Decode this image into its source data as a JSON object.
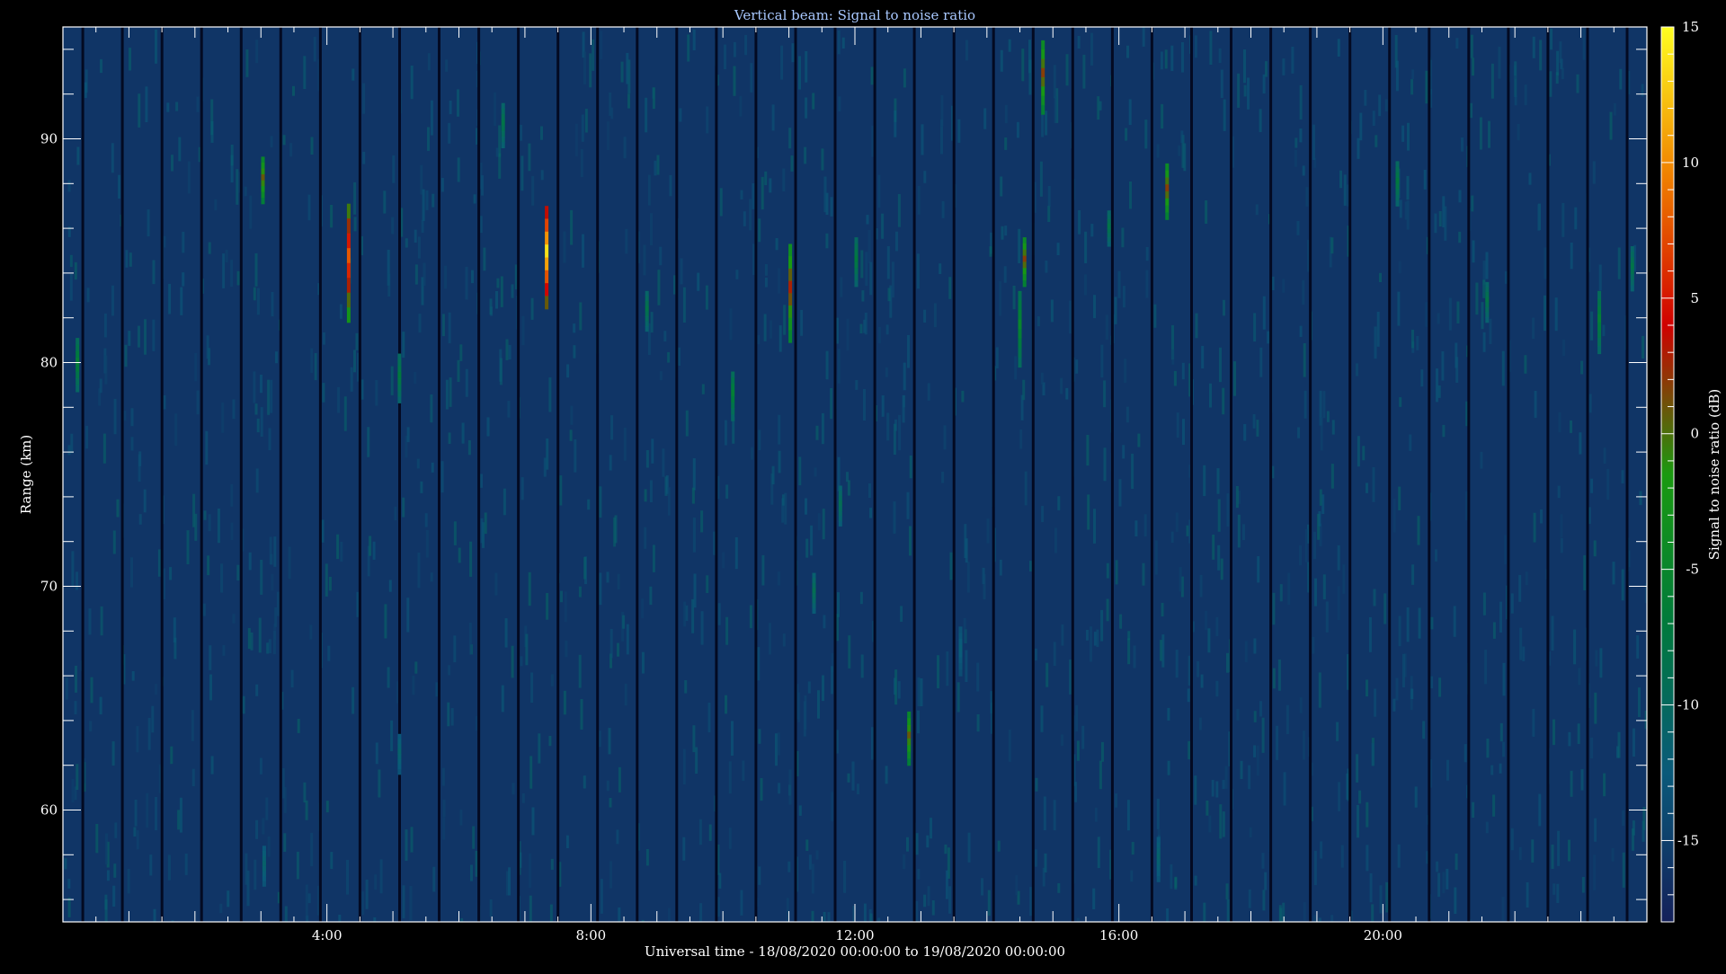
{
  "chart_data": {
    "type": "heatmap",
    "title": "Vertical beam: Signal to noise ratio",
    "xlabel": "Universal time - 18/08/2020 00:00:00 to 19/08/2020 00:00:00",
    "ylabel": "Range (km)",
    "xlim_hours": [
      0,
      24
    ],
    "ylim": [
      55,
      95
    ],
    "x_ticks": [
      {
        "value": 4,
        "label": "4:00"
      },
      {
        "value": 8,
        "label": "8:00"
      },
      {
        "value": 12,
        "label": "12:00"
      },
      {
        "value": 16,
        "label": "16:00"
      },
      {
        "value": 20,
        "label": "20:00"
      }
    ],
    "y_ticks": [
      {
        "value": 60,
        "label": "60"
      },
      {
        "value": 70,
        "label": "70"
      },
      {
        "value": 80,
        "label": "80"
      },
      {
        "value": 90,
        "label": "90"
      }
    ],
    "colorbar": {
      "label": "Signal to noise ratio (dB)",
      "range": [
        -18,
        15
      ],
      "ticks": [
        {
          "value": 15,
          "label": "15"
        },
        {
          "value": 10,
          "label": "10"
        },
        {
          "value": 5,
          "label": "5"
        },
        {
          "value": 0,
          "label": "0"
        },
        {
          "value": -5,
          "label": "-5"
        },
        {
          "value": -10,
          "label": "-10"
        },
        {
          "value": -15,
          "label": "-15"
        }
      ],
      "colors": [
        "#14205a",
        "#0a5a7a",
        "#007a3c",
        "#1a9a10",
        "#d00000",
        "#f08000",
        "#ffff20"
      ]
    },
    "background_snr_db": -16,
    "echoes": [
      {
        "t": 0.22,
        "r_min": 78.7,
        "r_max": 81.1,
        "peak_snr": -6
      },
      {
        "t": 3.03,
        "r_min": 87.1,
        "r_max": 89.2,
        "peak_snr": 1
      },
      {
        "t": 4.33,
        "r_min": 81.8,
        "r_max": 87.1,
        "peak_snr": 8
      },
      {
        "t": 5.1,
        "r_min": 78.2,
        "r_max": 80.4,
        "peak_snr": -7
      },
      {
        "t": 6.67,
        "r_min": 89.6,
        "r_max": 91.6,
        "peak_snr": -8
      },
      {
        "t": 7.33,
        "r_min": 82.4,
        "r_max": 87.0,
        "peak_snr": 14
      },
      {
        "t": 8.85,
        "r_min": 81.4,
        "r_max": 83.2,
        "peak_snr": -8
      },
      {
        "t": 10.15,
        "r_min": 77.4,
        "r_max": 79.6,
        "peak_snr": -6
      },
      {
        "t": 11.02,
        "r_min": 80.9,
        "r_max": 85.3,
        "peak_snr": 3
      },
      {
        "t": 11.78,
        "r_min": 72.7,
        "r_max": 74.5,
        "peak_snr": -9
      },
      {
        "t": 12.02,
        "r_min": 83.4,
        "r_max": 85.6,
        "peak_snr": -7
      },
      {
        "t": 11.38,
        "r_min": 68.8,
        "r_max": 70.6,
        "peak_snr": -9
      },
      {
        "t": 12.82,
        "r_min": 62.0,
        "r_max": 64.4,
        "peak_snr": 1
      },
      {
        "t": 14.5,
        "r_min": 79.8,
        "r_max": 83.2,
        "peak_snr": -5
      },
      {
        "t": 14.57,
        "r_min": 83.4,
        "r_max": 85.6,
        "peak_snr": 2
      },
      {
        "t": 14.85,
        "r_min": 91.1,
        "r_max": 94.4,
        "peak_snr": 2
      },
      {
        "t": 15.85,
        "r_min": 85.2,
        "r_max": 86.8,
        "peak_snr": -8
      },
      {
        "t": 16.73,
        "r_min": 86.4,
        "r_max": 88.9,
        "peak_snr": 2
      },
      {
        "t": 20.22,
        "r_min": 87.0,
        "r_max": 89.0,
        "peak_snr": -7
      },
      {
        "t": 21.58,
        "r_min": 81.8,
        "r_max": 83.6,
        "peak_snr": -8
      },
      {
        "t": 23.28,
        "r_min": 80.4,
        "r_max": 83.2,
        "peak_snr": -6
      },
      {
        "t": 23.78,
        "r_min": 83.2,
        "r_max": 85.2,
        "peak_snr": -8
      },
      {
        "t": 3.05,
        "r_min": 56.6,
        "r_max": 58.4,
        "peak_snr": -11
      },
      {
        "t": 5.1,
        "r_min": 61.6,
        "r_max": 63.4,
        "peak_snr": -11
      },
      {
        "t": 16.6,
        "r_min": 56.8,
        "r_max": 58.8,
        "peak_snr": -11
      },
      {
        "t": 13.6,
        "r_min": 66.0,
        "r_max": 68.2,
        "peak_snr": -12
      }
    ]
  }
}
